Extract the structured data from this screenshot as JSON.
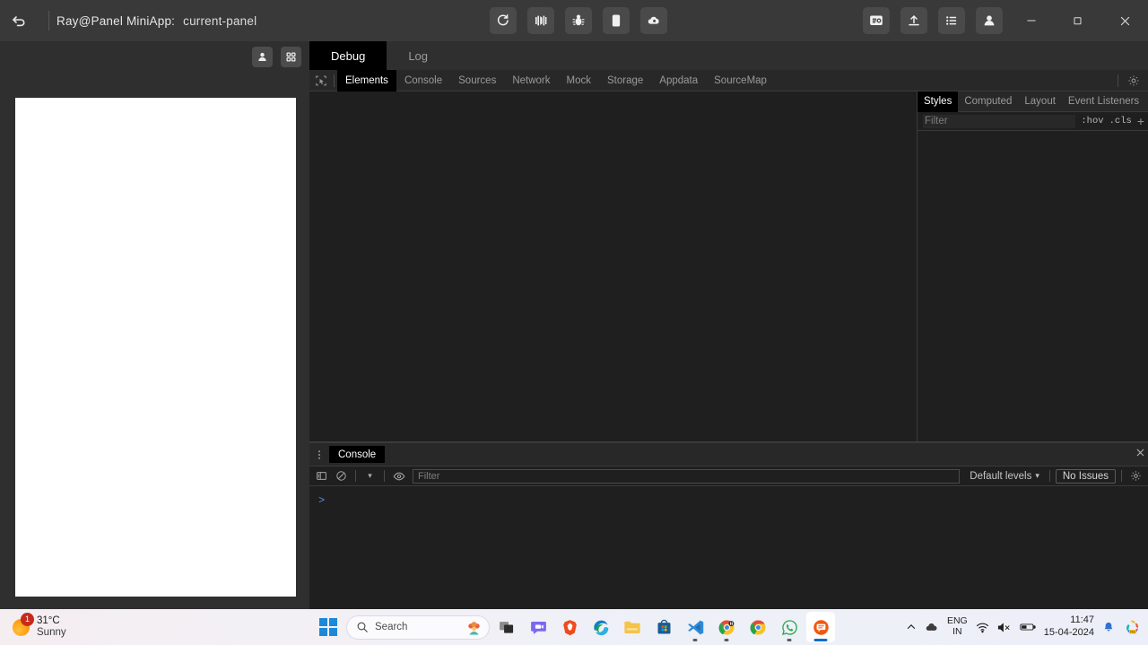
{
  "titlebar": {
    "back_icon": "back-arrow-icon",
    "app_title": "Ray@Panel MiniApp:",
    "page_name": "current-panel",
    "center_buttons": [
      {
        "name": "refresh-button",
        "icon": "refresh-icon"
      },
      {
        "name": "compile-button",
        "icon": "compile-icon"
      },
      {
        "name": "debug-button",
        "icon": "bug-icon"
      },
      {
        "name": "device-preview-button",
        "icon": "phone-icon"
      },
      {
        "name": "clear-cache-button",
        "icon": "cloud-cache-icon"
      }
    ],
    "right_buttons": [
      {
        "name": "remote-debug-button",
        "icon": "screen-icon"
      },
      {
        "name": "upload-button",
        "icon": "upload-icon"
      },
      {
        "name": "details-button",
        "icon": "list-icon"
      },
      {
        "name": "account-button",
        "icon": "user-icon"
      }
    ],
    "window_controls": {
      "minimize": "minimize-icon",
      "maximize": "maximize-icon",
      "close": "close-icon"
    }
  },
  "simulator": {
    "buttons": [
      {
        "name": "simulator-user-button",
        "icon": "user-icon"
      },
      {
        "name": "simulator-grid-button",
        "icon": "grid-icon"
      }
    ],
    "screen_state": ""
  },
  "devtools": {
    "top_tabs": [
      {
        "label": "Debug",
        "active": true
      },
      {
        "label": "Log",
        "active": false
      }
    ],
    "inspect_icon": "inspect-element-icon",
    "panel_tabs": [
      {
        "label": "Elements",
        "active": true
      },
      {
        "label": "Console",
        "active": false
      },
      {
        "label": "Sources",
        "active": false
      },
      {
        "label": "Network",
        "active": false
      },
      {
        "label": "Mock",
        "active": false
      },
      {
        "label": "Storage",
        "active": false
      },
      {
        "label": "Appdata",
        "active": false
      },
      {
        "label": "SourceMap",
        "active": false
      }
    ],
    "settings_icon": "gear-icon",
    "elements_tree": "",
    "styles": {
      "tabs": [
        {
          "label": "Styles",
          "active": true
        },
        {
          "label": "Computed",
          "active": false
        },
        {
          "label": "Layout",
          "active": false
        },
        {
          "label": "Event Listeners",
          "active": false
        }
      ],
      "more_tabs": "»",
      "filter_placeholder": "Filter",
      "hov_label": ":hov",
      "cls_label": ".cls",
      "new_rule": "+"
    },
    "drawer": {
      "kebab_icon": "more-options-icon",
      "tab_label": "Console",
      "close_icon": "close-icon",
      "toolbar": {
        "sidebar_icon": "console-sidebar-icon",
        "clear_icon": "clear-console-icon",
        "context_dropdown": "▾",
        "eye_icon": "live-expression-icon",
        "filter_placeholder": "Filter",
        "levels_label": "Default levels",
        "levels_caret": "▾",
        "issues_label": "No Issues",
        "settings_icon": "gear-icon"
      },
      "prompt": ">"
    }
  },
  "taskbar": {
    "weather": {
      "temperature": "31°C",
      "condition": "Sunny",
      "badge": "1"
    },
    "start_button": "windows-start-icon",
    "search": {
      "placeholder": "Search",
      "icon": "search-icon"
    },
    "pinned": [
      {
        "name": "task-view",
        "icon": "task-view-icon"
      },
      {
        "name": "chat",
        "icon": "chat-icon"
      },
      {
        "name": "brave-browser",
        "icon": "brave-icon"
      },
      {
        "name": "edge-browser",
        "icon": "edge-icon"
      },
      {
        "name": "file-explorer",
        "icon": "folder-icon"
      },
      {
        "name": "microsoft-store",
        "icon": "store-icon"
      },
      {
        "name": "visual-studio-code",
        "icon": "vscode-icon"
      },
      {
        "name": "chrome-beta",
        "icon": "chrome-icon"
      },
      {
        "name": "google-chrome",
        "icon": "chrome-icon"
      },
      {
        "name": "whatsapp",
        "icon": "whatsapp-icon"
      },
      {
        "name": "devtools-app",
        "icon": "miniapp-devtools-icon"
      }
    ],
    "tray": {
      "overflow_icon": "chevron-up-icon",
      "cloud_icon": "cloud-icon",
      "language": "ENG",
      "region": "IN",
      "wifi_icon": "wifi-icon",
      "volume_icon": "volume-muted-icon",
      "battery_icon": "battery-icon",
      "time": "11:47",
      "date": "15-04-2024",
      "notification_icon": "bell-icon",
      "copilot_icon": "copilot-icon"
    }
  },
  "colors": {
    "titlebar_bg": "#393939",
    "devtools_bg": "#1f1f1f",
    "active_tab_bg": "#000000",
    "taskbar_bg": "#eef0f8",
    "accent_blue": "#1b88d8",
    "badge_red": "#c42b1c"
  }
}
